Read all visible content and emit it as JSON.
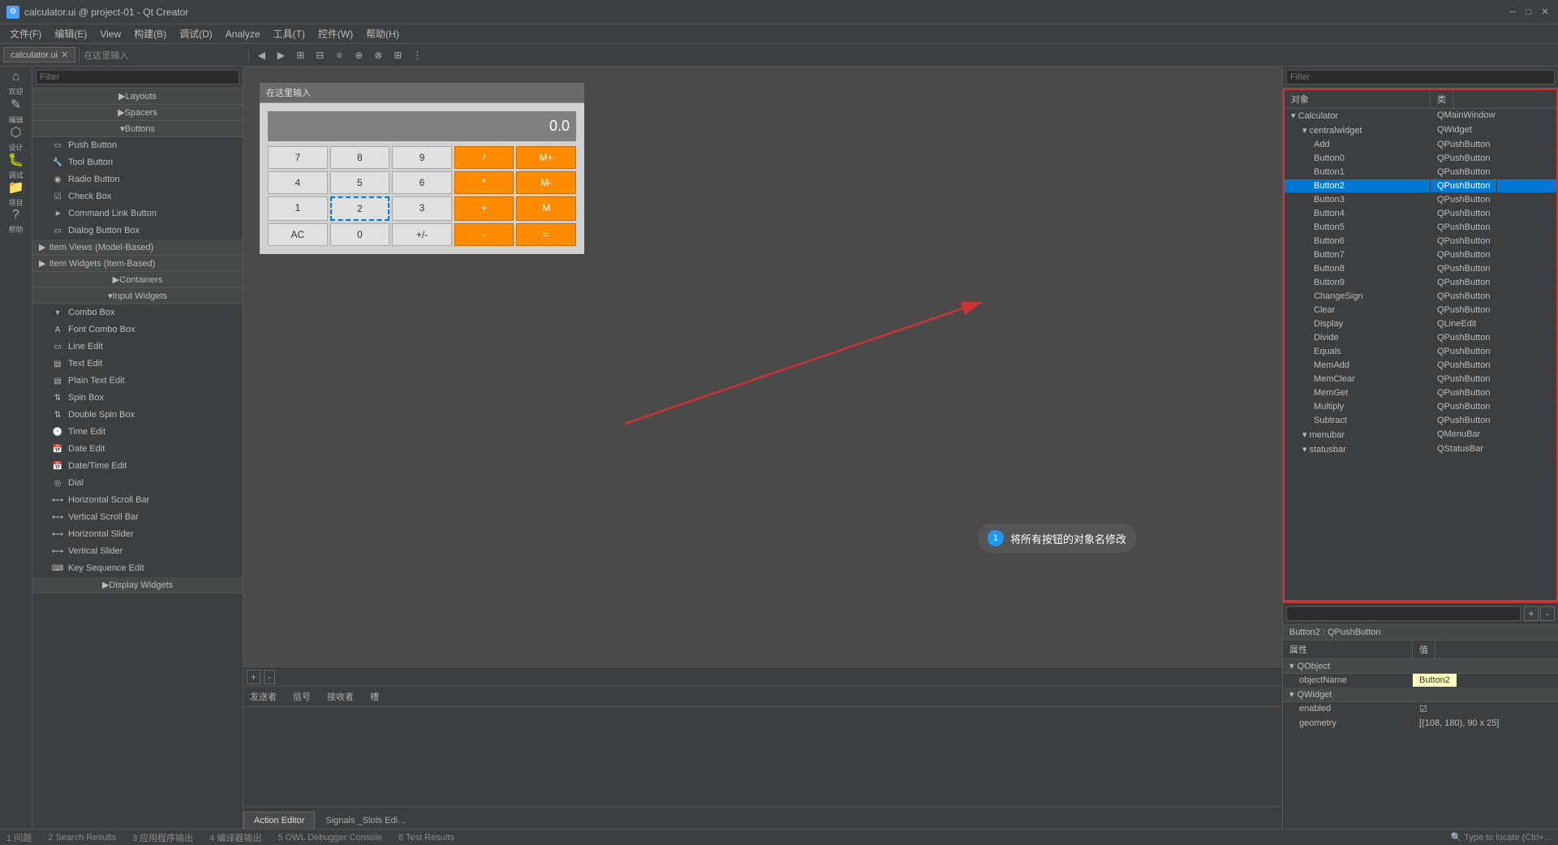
{
  "titlebar": {
    "title": "calculator.ui @ project-01 - Qt Creator",
    "minimize": "─",
    "maximize": "□",
    "close": "✕"
  },
  "menubar": {
    "items": [
      "文件(F)",
      "编辑(E)",
      "View",
      "构建(B)",
      "调试(D)",
      "Analyze",
      "工具(T)",
      "控件(W)",
      "帮助(H)"
    ]
  },
  "toolbar": {
    "tab_label": "calculator.ui",
    "address": "在这里输入"
  },
  "left_filter": {
    "placeholder": "Filter"
  },
  "right_filter": {
    "placeholder": "Filter"
  },
  "prop_filter": {
    "placeholder": ""
  },
  "widget_categories": [
    {
      "id": "layouts",
      "label": "Layouts",
      "expanded": false
    },
    {
      "id": "spacers",
      "label": "Spacers",
      "expanded": false
    },
    {
      "id": "buttons",
      "label": "Buttons",
      "expanded": true
    },
    {
      "id": "input_widgets",
      "label": "Input Widgets",
      "expanded": true
    },
    {
      "id": "display_widgets",
      "label": "Display Widgets",
      "expanded": false
    },
    {
      "id": "containers",
      "label": "Containers",
      "expanded": false
    },
    {
      "id": "item_views",
      "label": "Item Views (Model-Based)",
      "expanded": false
    },
    {
      "id": "item_widgets",
      "label": "Item Widgets (Item-Based)",
      "expanded": false
    }
  ],
  "button_widgets": [
    {
      "label": "Push Button",
      "icon": "▭"
    },
    {
      "label": "Tool Button",
      "icon": "🔧"
    },
    {
      "label": "Radio Button",
      "icon": "◉"
    },
    {
      "label": "Check Box",
      "icon": "☑"
    },
    {
      "label": "Command Link Button",
      "icon": "➤"
    },
    {
      "label": "Dialog Button Box",
      "icon": "▭"
    }
  ],
  "input_widgets": [
    {
      "label": "Combo Box",
      "icon": "▾"
    },
    {
      "label": "Font Combo Box",
      "icon": "A"
    },
    {
      "label": "Line Edit",
      "icon": "▭"
    },
    {
      "label": "Text Edit",
      "icon": "▤"
    },
    {
      "label": "Plain Text Edit",
      "icon": "▤"
    },
    {
      "label": "Spin Box",
      "icon": "⇅"
    },
    {
      "label": "Double Spin Box",
      "icon": "⇅"
    },
    {
      "label": "Time Edit",
      "icon": "🕐"
    },
    {
      "label": "Date Edit",
      "icon": "📅"
    },
    {
      "label": "Date/Time Edit",
      "icon": "📅"
    },
    {
      "label": "Dial",
      "icon": "◎"
    },
    {
      "label": "Horizontal Scroll Bar",
      "icon": "⟷"
    },
    {
      "label": "Vertical Scroll Bar",
      "icon": "⟷"
    },
    {
      "label": "Horizontal Slider",
      "icon": "⟷"
    },
    {
      "label": "Vertical Slider",
      "icon": "⟷"
    },
    {
      "label": "Key Sequence Edit",
      "icon": "⌨"
    }
  ],
  "calculator": {
    "display": "0.0",
    "buttons": [
      [
        "7",
        "8",
        "9",
        "/",
        "M+"
      ],
      [
        "4",
        "5",
        "6",
        "*",
        "M-"
      ],
      [
        "1",
        "2",
        "3",
        "+",
        "M"
      ],
      [
        "AC",
        "0",
        "+/-",
        "-",
        "="
      ]
    ]
  },
  "tooltip": {
    "number": "1",
    "text": "将所有按钮的对象名修改"
  },
  "object_inspector": {
    "header": [
      "对象",
      "类"
    ],
    "items": [
      {
        "indent": 0,
        "name": "Calculator",
        "class": "QMainWindow",
        "expanded": true
      },
      {
        "indent": 1,
        "name": "centralwidget",
        "class": "QWidget",
        "expanded": true,
        "icon": "widget"
      },
      {
        "indent": 2,
        "name": "Add",
        "class": "QPushButton"
      },
      {
        "indent": 2,
        "name": "Button0",
        "class": "QPushButton"
      },
      {
        "indent": 2,
        "name": "Button1",
        "class": "QPushButton"
      },
      {
        "indent": 2,
        "name": "Button2",
        "class": "QPushButton",
        "selected": true
      },
      {
        "indent": 2,
        "name": "Button3",
        "class": "QPushButton"
      },
      {
        "indent": 2,
        "name": "Button4",
        "class": "QPushButton"
      },
      {
        "indent": 2,
        "name": "Button5",
        "class": "QPushButton"
      },
      {
        "indent": 2,
        "name": "Button6",
        "class": "QPushButton"
      },
      {
        "indent": 2,
        "name": "Button7",
        "class": "QPushButton"
      },
      {
        "indent": 2,
        "name": "Button8",
        "class": "QPushButton"
      },
      {
        "indent": 2,
        "name": "Button9",
        "class": "QPushButton"
      },
      {
        "indent": 2,
        "name": "ChangeSign",
        "class": "QPushButton"
      },
      {
        "indent": 2,
        "name": "Clear",
        "class": "QPushButton"
      },
      {
        "indent": 2,
        "name": "Display",
        "class": "QLineEdit"
      },
      {
        "indent": 2,
        "name": "Divide",
        "class": "QPushButton"
      },
      {
        "indent": 2,
        "name": "Equals",
        "class": "QPushButton"
      },
      {
        "indent": 2,
        "name": "MemAdd",
        "class": "QPushButton"
      },
      {
        "indent": 2,
        "name": "MemClear",
        "class": "QPushButton"
      },
      {
        "indent": 2,
        "name": "MemGet",
        "class": "QPushButton"
      },
      {
        "indent": 2,
        "name": "Multiply",
        "class": "QPushButton"
      },
      {
        "indent": 2,
        "name": "Subtract",
        "class": "QPushButton"
      },
      {
        "indent": 1,
        "name": "menubar",
        "class": "QMenuBar"
      },
      {
        "indent": 1,
        "name": "statusbar",
        "class": "QStatusBar"
      }
    ]
  },
  "property_editor": {
    "title": "Button2 : QPushButton",
    "header": [
      "属性",
      "值"
    ],
    "sections": [
      {
        "name": "QObject",
        "properties": [
          {
            "name": "objectName",
            "value": "Button2",
            "highlight": true
          }
        ]
      },
      {
        "name": "QWidget",
        "properties": [
          {
            "name": "enabled",
            "value": "☑",
            "highlight": false
          },
          {
            "name": "geometry",
            "value": "[(108, 180), 90 x 25]",
            "highlight": false
          }
        ]
      }
    ]
  },
  "sidebar_icons": [
    {
      "id": "welcome",
      "label": "欢迎",
      "icon": "⌂"
    },
    {
      "id": "edit",
      "label": "编辑",
      "icon": "✎"
    },
    {
      "id": "design",
      "label": "设计",
      "icon": "⬡"
    },
    {
      "id": "debug",
      "label": "调试",
      "icon": "🐛"
    },
    {
      "id": "project",
      "label": "项目",
      "icon": "📁"
    },
    {
      "id": "help",
      "label": "帮助",
      "icon": "?"
    }
  ],
  "bottom_tabs": [
    {
      "label": "Action Editor",
      "active": true
    },
    {
      "label": "Signals _Slots Edi…",
      "active": false
    }
  ],
  "status_items": [
    "1 问题",
    "2 Search Results",
    "3 应用程序输出",
    "4 编译器输出",
    "5 OWL Debugger Console",
    "8 Test Results"
  ],
  "connection_header": [
    "发送者",
    "信号",
    "接收者",
    "槽"
  ]
}
